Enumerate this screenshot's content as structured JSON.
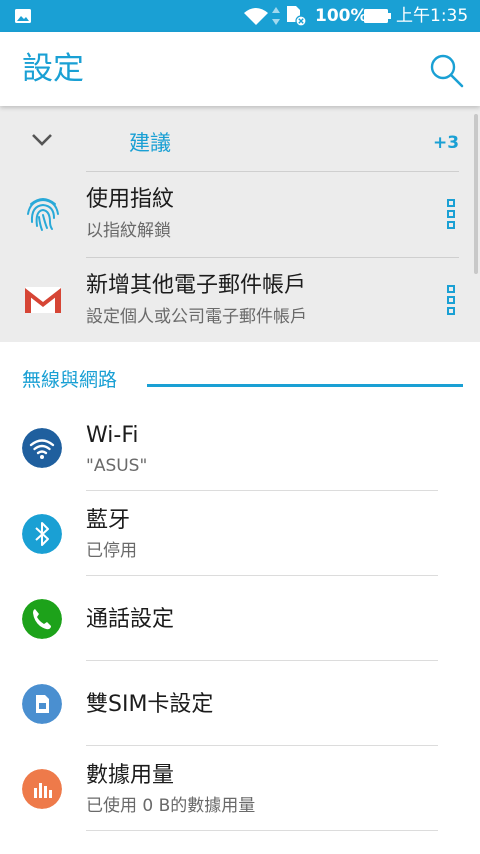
{
  "status_bar": {
    "battery_text": "100%",
    "time": "上午1:35",
    "background": "#1aa0d4",
    "icons": [
      "image-notification-icon",
      "wifi-icon",
      "data-activity-icon",
      "sim-card-off-icon",
      "battery-icon"
    ]
  },
  "header": {
    "title": "設定",
    "search_icon": "search-icon",
    "accent": "#1aa0d4"
  },
  "suggestions": {
    "label": "建議",
    "count": "+3",
    "items": [
      {
        "title": "使用指紋",
        "subtitle": "以指紋解鎖",
        "icon": "fingerprint-icon"
      },
      {
        "title": "新增其他電子郵件帳戶",
        "subtitle": "設定個人或公司電子郵件帳戶",
        "icon": "gmail-icon"
      }
    ]
  },
  "section": {
    "title": "無線與網路",
    "items": [
      {
        "title": "Wi-Fi",
        "subtitle": "\"ASUS\"",
        "icon": "wifi-icon",
        "color": "#1f5f9e"
      },
      {
        "title": "藍牙",
        "subtitle": "已停用",
        "icon": "bluetooth-icon",
        "color": "#1aa0d4"
      },
      {
        "title": "通話設定",
        "subtitle": "",
        "icon": "phone-icon",
        "color": "#1da21a"
      },
      {
        "title": "雙SIM卡設定",
        "subtitle": "",
        "icon": "sim-card-icon",
        "color": "#4a8fd0"
      },
      {
        "title": "數據用量",
        "subtitle": "已使用 0 B的數據用量",
        "icon": "data-usage-icon",
        "color": "#ee7a4a"
      }
    ]
  }
}
